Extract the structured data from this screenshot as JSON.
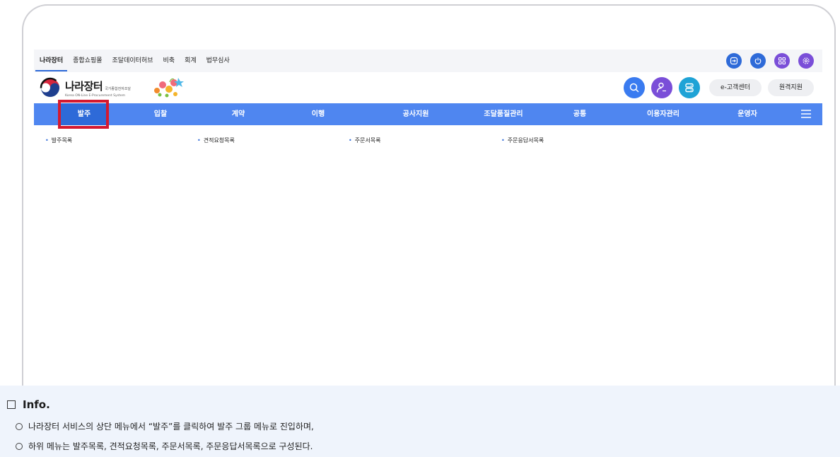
{
  "utility": {
    "links": [
      "나라장터",
      "종합쇼핑몰",
      "조달데이터허브",
      "비축",
      "회계",
      "법무심사"
    ],
    "icons": [
      {
        "name": "logout-icon",
        "color": "#2e6ad8"
      },
      {
        "name": "power-icon",
        "color": "#2e6ad8"
      },
      {
        "name": "apps-grid-icon",
        "color": "#7a4ed8"
      },
      {
        "name": "gear-icon",
        "color": "#7a4ed8"
      }
    ]
  },
  "header": {
    "logo_title": "나라장터",
    "logo_subtitle": "국가종합전자조달",
    "logo_english": "Korea ON-Line E-Procurement System",
    "buttons": {
      "search_color": "#3a7bf0",
      "user_color": "#7a4ed8",
      "server_color": "#1fa3d6",
      "customer_center": "e-고객센터",
      "remote_support": "원격지원"
    }
  },
  "nav": {
    "items": [
      "발주",
      "입찰",
      "계약",
      "이행",
      "공사지원",
      "조달품질관리",
      "공통",
      "이용자관리",
      "운영자"
    ],
    "active_index": 0,
    "bar_color": "#4f86f0",
    "active_color": "#2e6ad8"
  },
  "submenu": {
    "items": [
      "발주목록",
      "견적요청목록",
      "주문서목록",
      "주문응답서목록"
    ]
  },
  "highlight_color": "#d5192f",
  "info": {
    "title": "Info.",
    "lines": [
      "나라장터 서비스의 상단 메뉴에서 “발주”를 클릭하여 발주 그룹 메뉴로 진입하며,",
      "하위 메뉴는 발주목록, 견적요청목록, 주문서목록, 주문응답서목록으로 구성된다."
    ]
  }
}
